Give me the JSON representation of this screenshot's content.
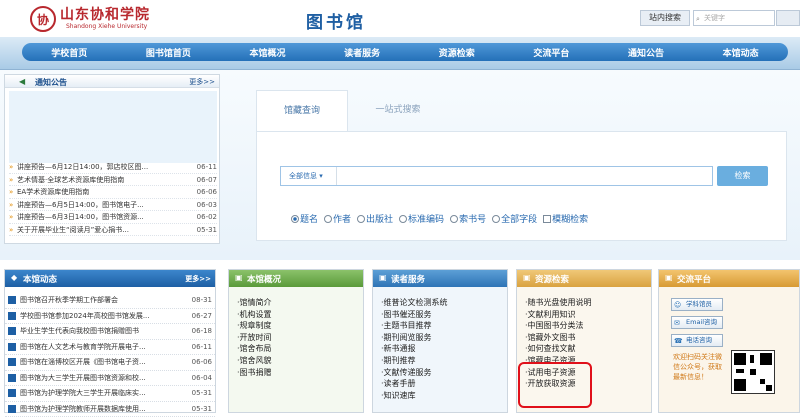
{
  "header": {
    "school_cn": "山东协和学院",
    "school_en": "Shandong Xiehe University",
    "seal_char": "协",
    "site_title": "图书馆",
    "search_label": "站内搜索",
    "search_placeholder": "关键字"
  },
  "nav": [
    "学校首页",
    "图书馆首页",
    "本馆概况",
    "读者服务",
    "资源检索",
    "交流平台",
    "通知公告",
    "本馆动态"
  ],
  "notice": {
    "title": "通知公告",
    "more": "更多>>",
    "items": [
      {
        "text": "讲座预告—6月12日14:00，郭店校区图...",
        "date": "06-11"
      },
      {
        "text": "艺术情基·全球艺术资源库使用指南",
        "date": "06-07"
      },
      {
        "text": "EA学术资源库使用指南",
        "date": "06-06"
      },
      {
        "text": "讲座预告—6月5日14:00，图书馆电子...",
        "date": "06-03"
      },
      {
        "text": "讲座预告—6月3日14:00，图书馆资源...",
        "date": "06-02"
      },
      {
        "text": "关于开展毕业生“阅读月”爱心捐书...",
        "date": "05-31"
      }
    ]
  },
  "search": {
    "tabs": [
      "馆藏查询",
      "一站式搜索"
    ],
    "select": "全部信息",
    "button": "检索",
    "options": [
      "题名",
      "作者",
      "出版社",
      "标准编码",
      "索书号",
      "全部字段"
    ],
    "fuzzy": "模糊检索"
  },
  "dynamics": {
    "title": "本馆动态",
    "more": "更多>>",
    "items": [
      {
        "text": "图书馆召开秋季学期工作部署会",
        "date": "08-31"
      },
      {
        "text": "学校图书馆参加2024年高校图书馆发展...",
        "date": "06-27"
      },
      {
        "text": "毕业生学生代表向我校图书馆捐赠图书",
        "date": "06-18"
      },
      {
        "text": "图书馆在人文艺术与教育学院开展电子...",
        "date": "06-11"
      },
      {
        "text": "图书馆在淄博校区开展《图书馆电子资...",
        "date": "06-06"
      },
      {
        "text": "图书馆为大三学生开展图书馆资源和校...",
        "date": "06-04"
      },
      {
        "text": "图书馆为护理学院大三学生开展临床实...",
        "date": "05-31"
      },
      {
        "text": "图书馆为护理学院教师开展数据库使用...",
        "date": "05-31"
      }
    ]
  },
  "overview": {
    "title": "本馆概况",
    "items": [
      "·馆情简介",
      "·机构设置",
      "·规章制度",
      "·开放时间",
      "·馆舍布局",
      "·馆舍风貌",
      "·图书捐赠"
    ]
  },
  "service": {
    "title": "读者服务",
    "items": [
      "·维普论文检测系统",
      "·图书催还服务",
      "·主题书目推荐",
      "·期刊阅览服务",
      "·新书通报",
      "·期刊推荐",
      "·文献传递服务",
      "·读者手册",
      "·知识速库"
    ]
  },
  "resource": {
    "title": "资源检索",
    "items": [
      "·随书光盘使用说明",
      "·文献利用知识",
      "·中国图书分类法",
      "·馆藏外文图书",
      "·如何查找文献",
      "·馆藏电子资源",
      "·试用电子资源",
      "·开放获取资源"
    ]
  },
  "exchange": {
    "title": "交流平台",
    "buttons": [
      "学科馆员",
      "Email咨询",
      "电话咨询"
    ],
    "wechat": "欢迎扫码关注微信公众号，获取最新信息！"
  },
  "colors": {
    "nav": "#2470b8",
    "accent_red": "#e0101a",
    "brand": "#b8282e"
  }
}
